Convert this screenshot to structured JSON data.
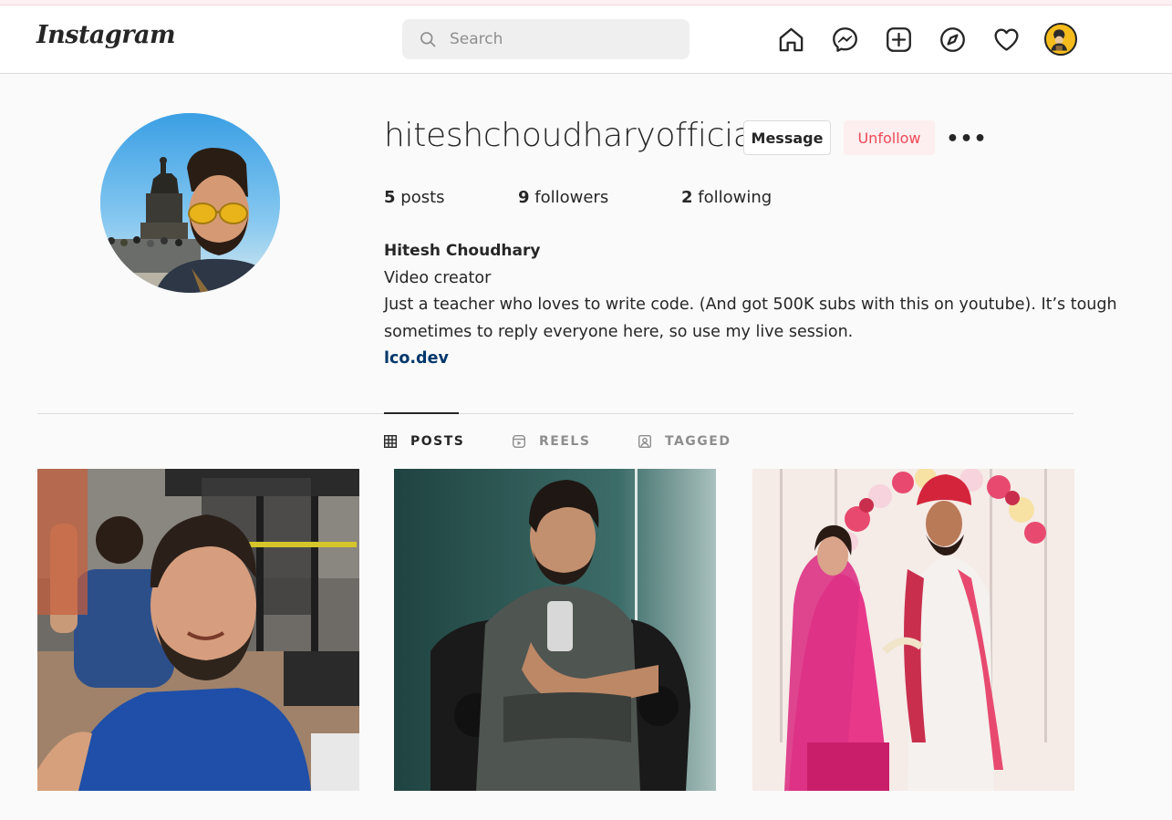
{
  "app": {
    "logo": "Instagram"
  },
  "search": {
    "placeholder": "Search"
  },
  "nav": {
    "icons": [
      "home-icon",
      "messenger-icon",
      "new-post-icon",
      "explore-icon",
      "activity-heart-icon"
    ]
  },
  "profile": {
    "username": "hiteshchoudharyofficial",
    "message_button": "Message",
    "unfollow_button": "Unfollow",
    "more_label": "•••",
    "stats": {
      "posts_count": "5",
      "posts_label": "posts",
      "followers_count": "9",
      "followers_label": "followers",
      "following_count": "2",
      "following_label": "following"
    },
    "full_name": "Hitesh Choudhary",
    "category": "Video creator",
    "bio_line1": "Just a teacher who loves to write code. (And got 500K subs with this on youtube). It’s tough",
    "bio_line2": "sometimes to reply everyone here, so use my live session.",
    "website": "lco.dev"
  },
  "tabs": [
    {
      "label": "POSTS",
      "icon": "grid-icon",
      "active": true
    },
    {
      "label": "REELS",
      "icon": "reels-icon",
      "active": false
    },
    {
      "label": "TAGGED",
      "icon": "tagged-icon",
      "active": false
    }
  ],
  "posts": [
    {
      "subject": "gym-selfie"
    },
    {
      "subject": "mirror-selfie"
    },
    {
      "subject": "wedding-photo"
    }
  ],
  "colors": {
    "unfollow_text": "#ed4956",
    "unfollow_bg": "#fdeeef",
    "link": "#00376b",
    "border": "#dbdbdb"
  }
}
